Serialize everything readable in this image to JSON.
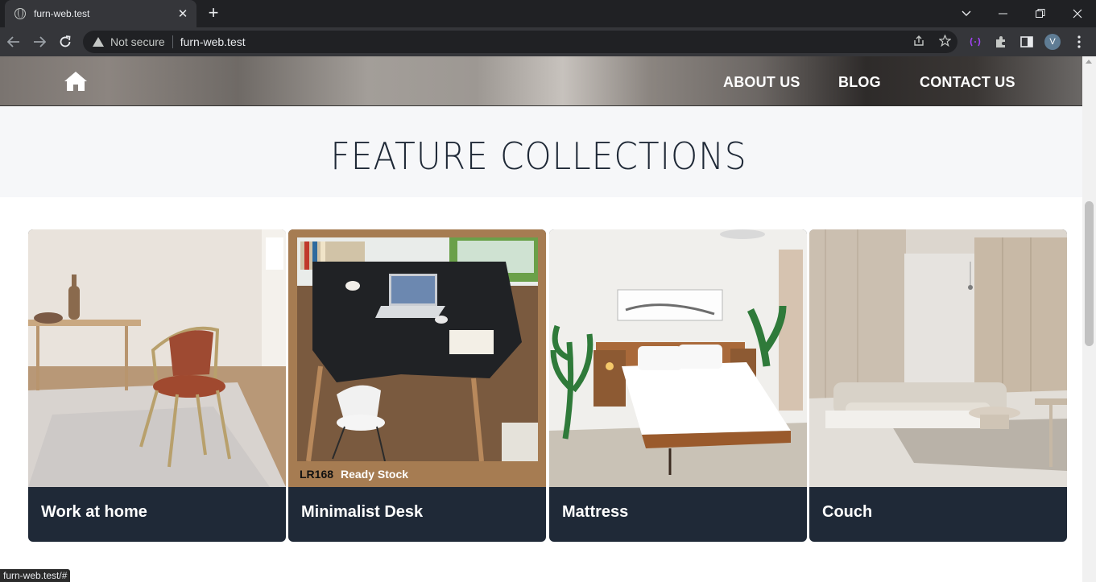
{
  "browser": {
    "tab_title": "furn-web.test",
    "tab_close": "✕",
    "new_tab": "+",
    "security_label": "Not secure",
    "url": "furn-web.test",
    "avatar_letter": "V",
    "status_url": "furn-web.test/#"
  },
  "site": {
    "nav": {
      "about": "ABOUT US",
      "blog": "BLOG",
      "contact": "CONTACT US"
    },
    "feature_title": "FEATURE COLLECTIONS",
    "cards": [
      {
        "label": "Work at home"
      },
      {
        "label": "Minimalist Desk",
        "badge_code": "LR168",
        "badge_text": "Ready Stock"
      },
      {
        "label": "Mattress"
      },
      {
        "label": "Couch"
      }
    ]
  },
  "colors": {
    "card_footer": "#1f2937",
    "desk_frame": "#a67c52",
    "title_text": "#1f2937"
  }
}
